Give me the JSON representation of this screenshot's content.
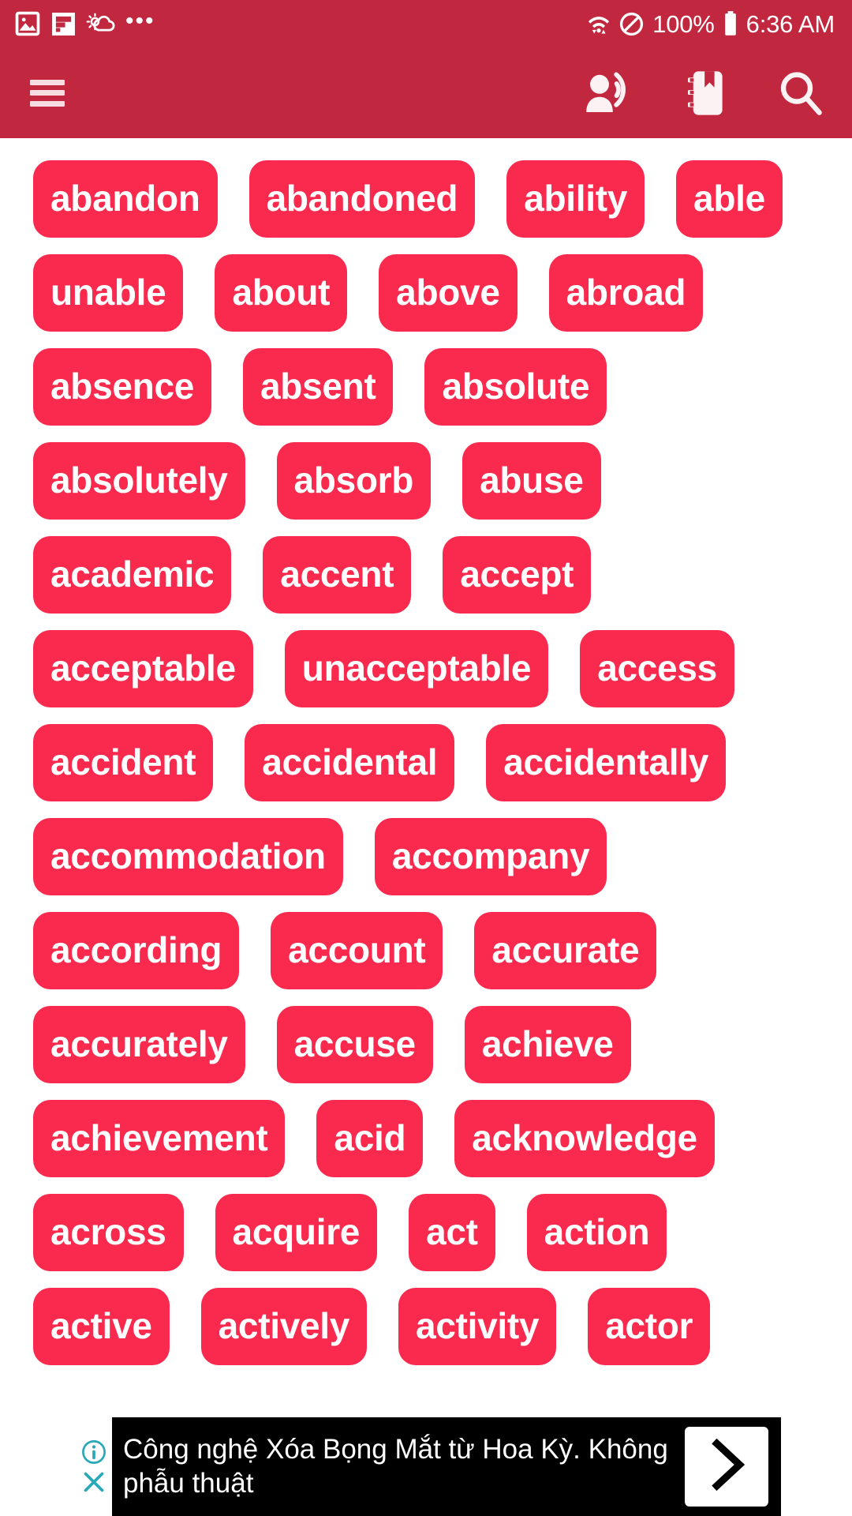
{
  "status_bar": {
    "left_icons": [
      "photo-icon",
      "flipboard-icon",
      "weather-cloud-sun-icon",
      "more-dots-icon"
    ],
    "right_icons": [
      "wifi-icon",
      "do-not-disturb-icon",
      "battery-icon"
    ],
    "battery_percent": "100%",
    "time": "6:36 AM"
  },
  "app_bar": {
    "menu_label": "menu",
    "actions": [
      {
        "name": "record-voice-over-icon",
        "label": "pronounce"
      },
      {
        "name": "notebook-icon",
        "label": "notebook"
      },
      {
        "name": "search-icon",
        "label": "search"
      }
    ]
  },
  "word_list": {
    "rows": [
      [
        "abandon",
        "abandoned",
        "ability",
        "able"
      ],
      [
        "unable",
        "about",
        "above",
        "abroad"
      ],
      [
        "absence",
        "absent",
        "absolute"
      ],
      [
        "absolutely",
        "absorb",
        "abuse"
      ],
      [
        "academic",
        "accent",
        "accept"
      ],
      [
        "acceptable",
        "unacceptable",
        "access"
      ],
      [
        "accident",
        "accidental",
        "accidentally"
      ],
      [
        "accommodation",
        "accompany"
      ],
      [
        "according",
        "account",
        "accurate"
      ],
      [
        "accurately",
        "accuse",
        "achieve"
      ],
      [
        "achievement",
        "acid",
        "acknowledge"
      ],
      [
        "across",
        "acquire",
        "act",
        "action"
      ],
      [
        "active",
        "actively",
        "activity",
        "actor"
      ]
    ]
  },
  "ad": {
    "text": "Công nghệ Xóa Bọng Mắt từ Hoa Kỳ. Không phẫu thuật",
    "info_icon": "info-icon",
    "close_icon": "close-icon",
    "cta_icon": "chevron-right-icon"
  },
  "colors": {
    "app_bar": "#C1283F",
    "chip": "#F92A4E",
    "chip_text": "#FFFFFF",
    "background": "#FFFFFF",
    "ad_background": "#000000",
    "ad_badge_accent": "#2AA8B8"
  }
}
